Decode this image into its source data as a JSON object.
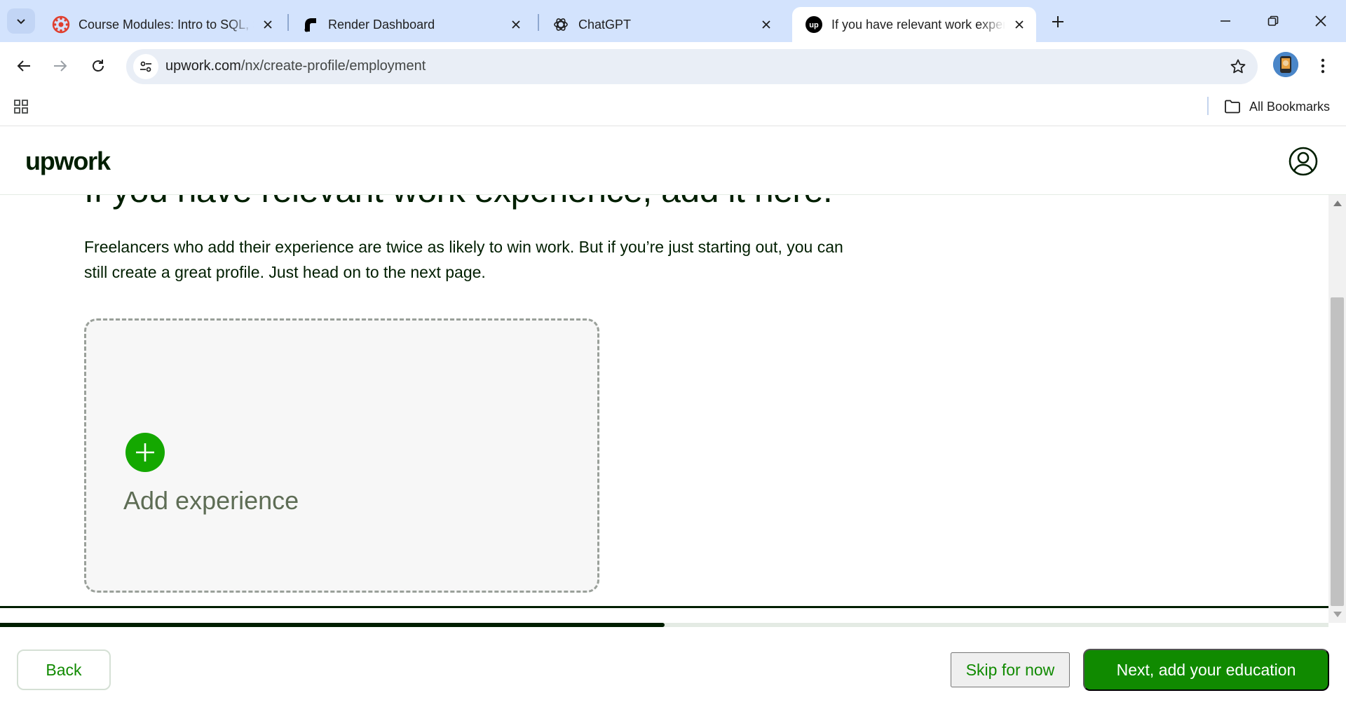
{
  "colors": {
    "tabstrip_bg": "#d3e3fd",
    "upwork_green": "#108a00",
    "plus_green": "#14a800",
    "text_dark": "#001e00"
  },
  "tabs": [
    {
      "title": "Course Modules: Intro to SQL, S",
      "icon": "canvas-lms-icon",
      "active": false
    },
    {
      "title": "Render Dashboard",
      "icon": "render-logo-icon",
      "active": false
    },
    {
      "title": "ChatGPT",
      "icon": "openai-logo-icon",
      "active": false
    },
    {
      "title": "If you have relevant work experi",
      "icon": "upwork-logo-icon",
      "active": true
    }
  ],
  "address_bar": {
    "domain": "upwork.com",
    "path": "/nx/create-profile/employment"
  },
  "bookmarks_bar": {
    "all_bookmarks_label": "All Bookmarks"
  },
  "upwork_header": {
    "logo_text": "upwork"
  },
  "main": {
    "heading": "If you have relevant work experience, add it here.",
    "description": "Freelancers who add their experience are twice as likely to win work. But if you’re just starting out, you can still create a great profile. Just head on to the next page.",
    "add_card_label": "Add experience"
  },
  "footer": {
    "progress_percent": 50,
    "back_label": "Back",
    "skip_label": "Skip for now",
    "next_label": "Next, add your education"
  }
}
